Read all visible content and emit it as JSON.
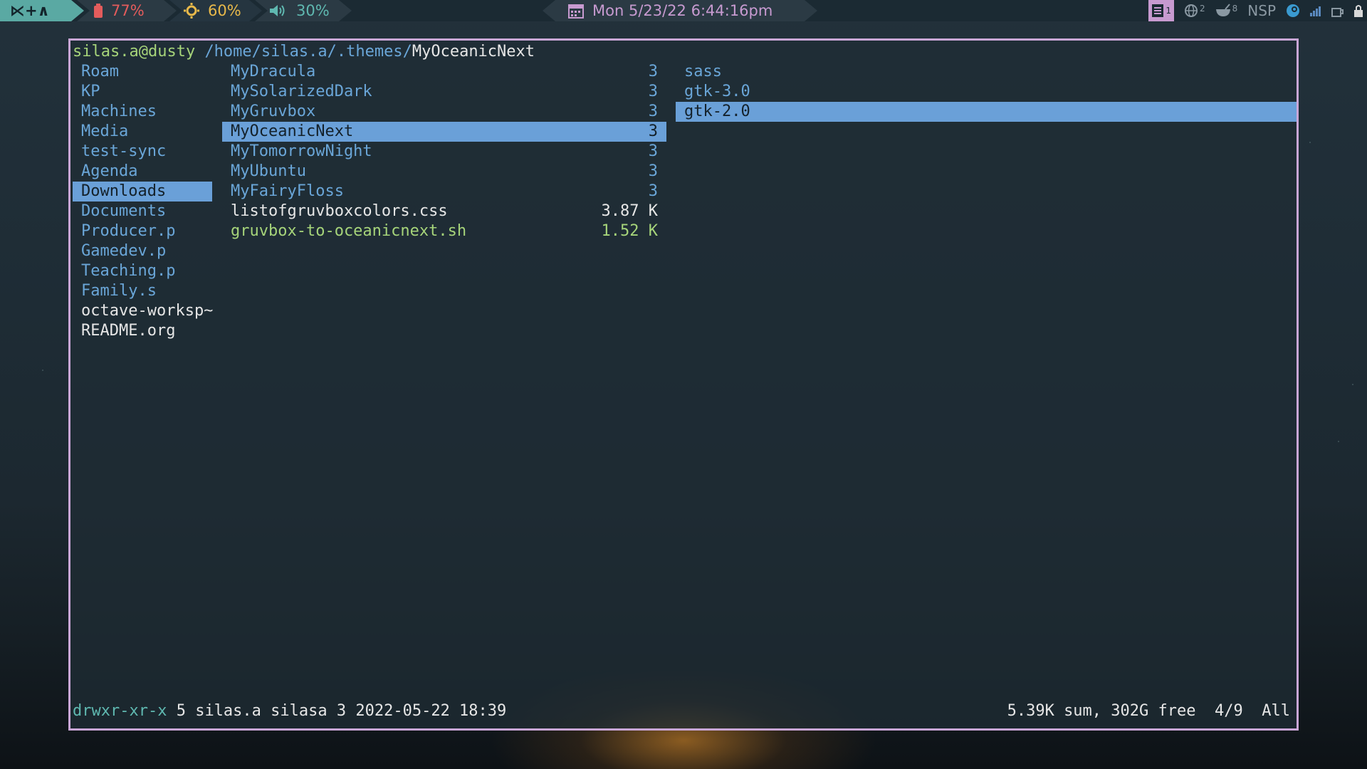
{
  "topbar": {
    "logo": "⋉+∧",
    "battery": "77%",
    "brightness": "60%",
    "volume": "30%",
    "clock": "Mon 5/23/22 6:44:16pm",
    "workspaces": [
      {
        "icon": "doc-icon",
        "num": "1"
      },
      {
        "icon": "globe-icon",
        "num": "2"
      },
      {
        "icon": "bowl-icon",
        "num": "8"
      }
    ],
    "scratchpad": "NSP"
  },
  "terminal": {
    "user_host": "silas.a@dusty",
    "path": "/home/silas.a/.themes/",
    "current": "MyOceanicNext",
    "parent": [
      {
        "name": "Roam",
        "kind": "dir"
      },
      {
        "name": "KP",
        "kind": "dir"
      },
      {
        "name": "Machines",
        "kind": "dir"
      },
      {
        "name": "Media",
        "kind": "dir"
      },
      {
        "name": "test-sync",
        "kind": "dir"
      },
      {
        "name": "Agenda",
        "kind": "dir"
      },
      {
        "name": "Downloads",
        "kind": "dir",
        "selected": true
      },
      {
        "name": "Documents",
        "kind": "dir"
      },
      {
        "name": "Producer.p",
        "kind": "dir"
      },
      {
        "name": "Gamedev.p",
        "kind": "dir"
      },
      {
        "name": "Teaching.p",
        "kind": "dir"
      },
      {
        "name": "Family.s",
        "kind": "dir"
      },
      {
        "name": "octave-worksp~",
        "kind": "file"
      },
      {
        "name": "README.org",
        "kind": "file"
      }
    ],
    "current_dir": [
      {
        "name": "MyDracula",
        "size": "3",
        "kind": "dir"
      },
      {
        "name": "MySolarizedDark",
        "size": "3",
        "kind": "dir"
      },
      {
        "name": "MyGruvbox",
        "size": "3",
        "kind": "dir"
      },
      {
        "name": "MyOceanicNext",
        "size": "3",
        "kind": "dir",
        "selected": true
      },
      {
        "name": "MyTomorrowNight",
        "size": "3",
        "kind": "dir"
      },
      {
        "name": "MyUbuntu",
        "size": "3",
        "kind": "dir"
      },
      {
        "name": "MyFairyFloss",
        "size": "3",
        "kind": "dir"
      },
      {
        "name": "listofgruvboxcolors.css",
        "size": "3.87 K",
        "kind": "file"
      },
      {
        "name": "gruvbox-to-oceanicnext.sh",
        "size": "1.52 K",
        "kind": "exec"
      }
    ],
    "preview": [
      {
        "name": "sass",
        "kind": "dir"
      },
      {
        "name": "gtk-3.0",
        "kind": "dir"
      },
      {
        "name": "gtk-2.0",
        "kind": "dir",
        "selected": true
      }
    ],
    "status": {
      "perms": "drwxr-xr-x",
      "info": "5 silas.a silasa 3 2022-05-22 18:39",
      "summary": "5.39K sum, 302G free",
      "position": "4/9",
      "scroll": "All"
    }
  }
}
